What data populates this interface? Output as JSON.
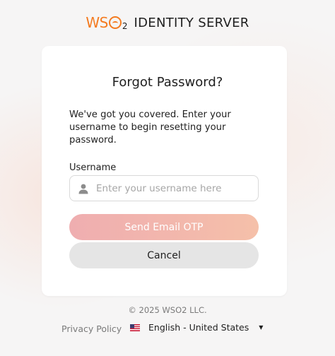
{
  "header": {
    "logo_text": "WSO2",
    "product_name": "IDENTITY SERVER",
    "brand_color": "#f47b20"
  },
  "card": {
    "title": "Forgot Password?",
    "description": "We've got you covered. Enter your username to begin resetting your password.",
    "username_label": "Username",
    "username_placeholder": "Enter your username here",
    "username_value": "",
    "user_icon": "user-icon",
    "send_button": "Send Email OTP",
    "cancel_button": "Cancel"
  },
  "footer": {
    "copyright": "© 2025 WSO2 LLC.",
    "privacy_link": "Privacy Policy",
    "language": "English - United States",
    "language_flag": "us-flag-icon",
    "language_caret": "chevron-down-icon"
  },
  "colors": {
    "background": "#f6f5f5",
    "card": "#ffffff",
    "primary_button_gradient_start": "#efaeb0",
    "primary_button_gradient_end": "#f5c0a9",
    "secondary_button": "#e5e5e5"
  }
}
